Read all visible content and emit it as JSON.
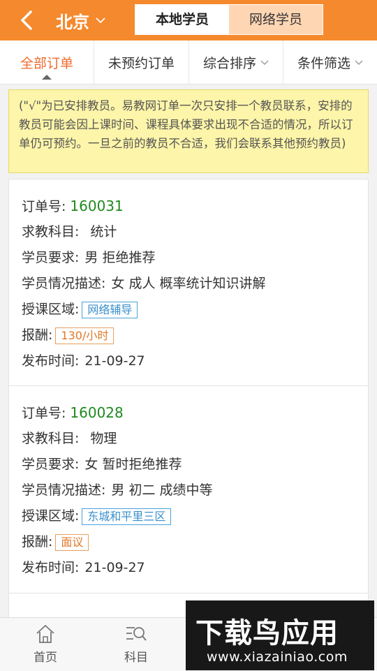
{
  "header": {
    "city": "北京",
    "segment": [
      {
        "label": "本地学员",
        "active": true
      },
      {
        "label": "网络学员",
        "active": false
      }
    ],
    "accent": "#f5892d"
  },
  "tabs": [
    {
      "label": "全部订单",
      "active": true,
      "dropdown": false
    },
    {
      "label": "未预约订单",
      "active": false,
      "dropdown": false
    },
    {
      "label": "综合排序",
      "active": false,
      "dropdown": true
    },
    {
      "label": "条件筛选",
      "active": false,
      "dropdown": true
    }
  ],
  "notice": "(\"√\"为已安排教员。易教网订单一次只安排一个教员联系，安排的教员可能会因上课时间、课程具体要求出现不合适的情况，所以订单仍可预约。一旦之前的教员不合适，我们会联系其他预约教员)",
  "labels": {
    "order_no": "订单号:",
    "subject": "求教科目:",
    "requirement": "学员要求:",
    "description": "学员情况描述:",
    "area": "授课区域:",
    "pay": "报酬:",
    "publish": "发布时间:"
  },
  "orders": [
    {
      "order_no": "160031",
      "subject": "统计",
      "requirement": "男 拒绝推荐",
      "description": "女 成人 概率统计知识讲解",
      "area": "网络辅导",
      "pay": "130/小时",
      "publish": "21-09-27"
    },
    {
      "order_no": "160028",
      "subject": "物理",
      "requirement": "女 暂时拒绝推荐",
      "description": "男 初二 成绩中等",
      "area": "东城和平里三区",
      "pay": "面议",
      "publish": "21-09-27"
    }
  ],
  "bottom_nav": [
    {
      "label": "首页",
      "icon": "home-icon"
    },
    {
      "label": "科目",
      "icon": "subject-search-icon"
    }
  ],
  "watermark": {
    "title": "下载鸟应用",
    "url": "www.xiazainiao.com"
  }
}
